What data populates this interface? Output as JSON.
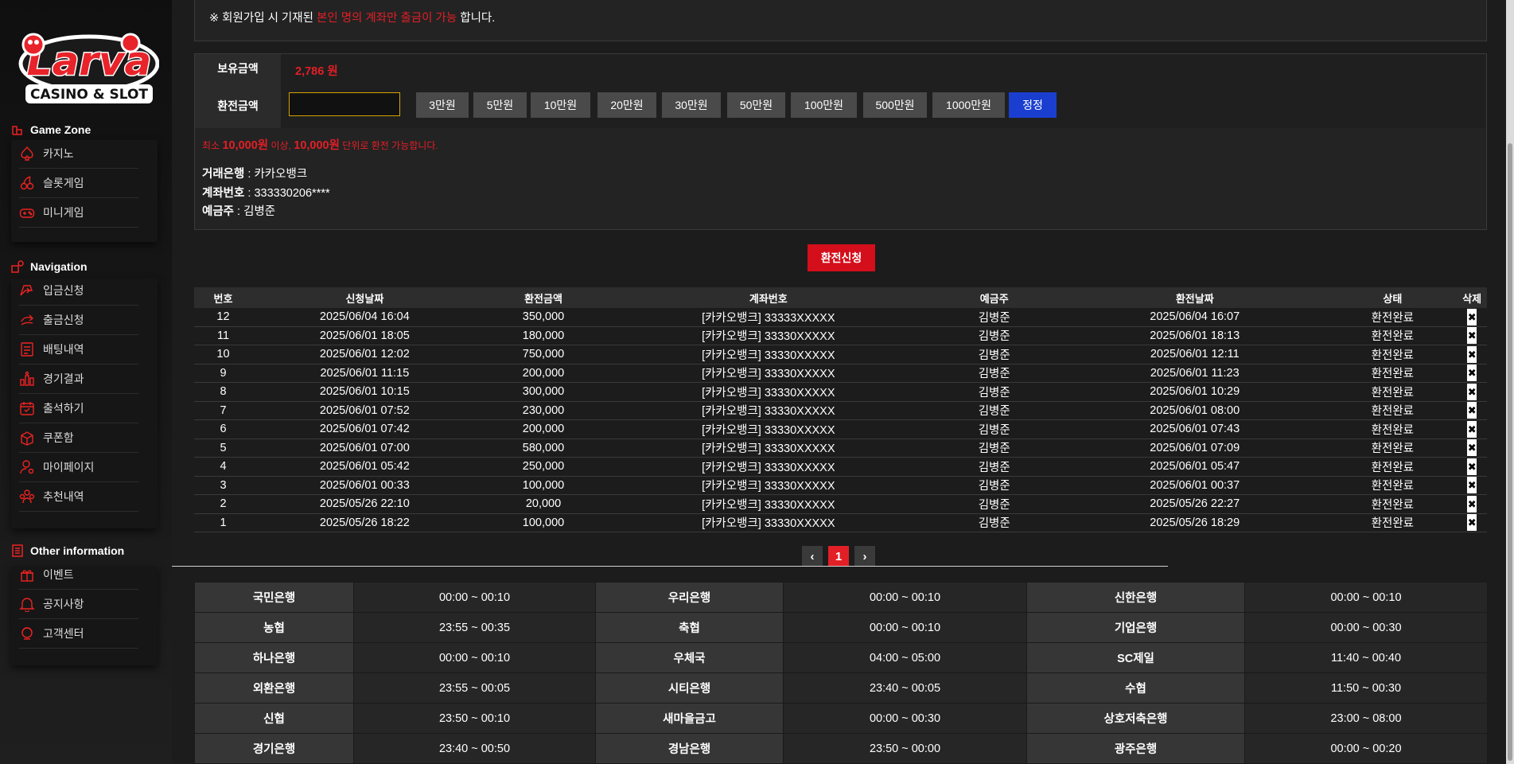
{
  "logo": {
    "brand": "Larva",
    "tagline": "CASINO & SLOT"
  },
  "sidebar": {
    "sections": [
      {
        "title": "Game Zone",
        "icon": "game-zone-icon",
        "items": [
          {
            "label": "카지노",
            "icon": "spade-icon"
          },
          {
            "label": "슬롯게임",
            "icon": "cherry-icon"
          },
          {
            "label": "미니게임",
            "icon": "gamepad-icon"
          }
        ]
      },
      {
        "title": "Navigation",
        "icon": "navigation-icon",
        "items": [
          {
            "label": "입금신청",
            "icon": "deposit-icon"
          },
          {
            "label": "출금신청",
            "icon": "withdraw-icon"
          },
          {
            "label": "배팅내역",
            "icon": "bet-history-icon"
          },
          {
            "label": "경기결과",
            "icon": "results-icon"
          },
          {
            "label": "출석하기",
            "icon": "calendar-icon"
          },
          {
            "label": "쿠폰함",
            "icon": "coupon-icon"
          },
          {
            "label": "마이페이지",
            "icon": "user-icon"
          },
          {
            "label": "추천내역",
            "icon": "referral-icon"
          }
        ]
      },
      {
        "title": "Other information",
        "icon": "info-icon",
        "items": [
          {
            "label": "이벤트",
            "icon": "gift-icon"
          },
          {
            "label": "공지사항",
            "icon": "bell-icon"
          },
          {
            "label": "고객센터",
            "icon": "support-icon"
          }
        ]
      }
    ]
  },
  "notice": {
    "prefix": "※ 회원가입 시 기재된",
    "highlight": "본인 명의 계좌만 출금이 가능",
    "suffix": "합니다."
  },
  "form": {
    "balance_label": "보유금액",
    "balance_value": "2,786 원",
    "amount_label": "환전금액",
    "amount_value": "",
    "amount_placeholder": "",
    "amount_buttons": [
      "3만원",
      "5만원",
      "10만원",
      "20만원",
      "30만원",
      "50만원",
      "100만원",
      "500만원",
      "1000만원"
    ],
    "reset_label": "정정",
    "min_text": {
      "p1": "최소",
      "v1": "10,000원",
      "p2": "이상,",
      "v2": "10,000원",
      "p3": "단위로 환전 가능합니다."
    },
    "bank_info": [
      {
        "label": "거래은행",
        "value": "카카오뱅크"
      },
      {
        "label": "계좌번호",
        "value": "333330206****"
      },
      {
        "label": "예금주",
        "value": "김병준"
      }
    ],
    "submit_label": "환전신청"
  },
  "history": {
    "columns": [
      "번호",
      "신청날짜",
      "환전금액",
      "계좌번호",
      "예금주",
      "환전날짜",
      "상태",
      "삭제"
    ],
    "delete_symbol": "✖",
    "rows": [
      [
        "12",
        "2025/06/04 16:04",
        "350,000",
        "[카카오뱅크] 33333XXXXX",
        "김병준",
        "2025/06/04 16:07",
        "환전완료"
      ],
      [
        "11",
        "2025/06/01 18:05",
        "180,000",
        "[카카오뱅크] 33330XXXXX",
        "김병준",
        "2025/06/01 18:13",
        "환전완료"
      ],
      [
        "10",
        "2025/06/01 12:02",
        "750,000",
        "[카카오뱅크] 33330XXXXX",
        "김병준",
        "2025/06/01 12:11",
        "환전완료"
      ],
      [
        "9",
        "2025/06/01 11:15",
        "200,000",
        "[카카오뱅크] 33330XXXXX",
        "김병준",
        "2025/06/01 11:23",
        "환전완료"
      ],
      [
        "8",
        "2025/06/01 10:15",
        "300,000",
        "[카카오뱅크] 33330XXXXX",
        "김병준",
        "2025/06/01 10:29",
        "환전완료"
      ],
      [
        "7",
        "2025/06/01 07:52",
        "230,000",
        "[카카오뱅크] 33330XXXXX",
        "김병준",
        "2025/06/01 08:00",
        "환전완료"
      ],
      [
        "6",
        "2025/06/01 07:42",
        "200,000",
        "[카카오뱅크] 33330XXXXX",
        "김병준",
        "2025/06/01 07:43",
        "환전완료"
      ],
      [
        "5",
        "2025/06/01 07:00",
        "580,000",
        "[카카오뱅크] 33330XXXXX",
        "김병준",
        "2025/06/01 07:09",
        "환전완료"
      ],
      [
        "4",
        "2025/06/01 05:42",
        "250,000",
        "[카카오뱅크] 33330XXXXX",
        "김병준",
        "2025/06/01 05:47",
        "환전완료"
      ],
      [
        "3",
        "2025/06/01 00:33",
        "100,000",
        "[카카오뱅크] 33330XXXXX",
        "김병준",
        "2025/06/01 00:37",
        "환전완료"
      ],
      [
        "2",
        "2025/05/26 22:10",
        "20,000",
        "[카카오뱅크] 33330XXXXX",
        "김병준",
        "2025/05/26 22:27",
        "환전완료"
      ],
      [
        "1",
        "2025/05/26 18:22",
        "100,000",
        "[카카오뱅크] 33330XXXXX",
        "김병준",
        "2025/05/26 18:29",
        "환전완료"
      ]
    ]
  },
  "pagination": {
    "prev": "‹",
    "current": "1",
    "next": "›"
  },
  "bank_hours": [
    [
      {
        "bank": "국민은행",
        "hours": "00:00 ~ 00:10"
      },
      {
        "bank": "우리은행",
        "hours": "00:00 ~ 00:10"
      },
      {
        "bank": "신한은행",
        "hours": "00:00 ~ 00:10"
      }
    ],
    [
      {
        "bank": "농협",
        "hours": "23:55 ~ 00:35"
      },
      {
        "bank": "축협",
        "hours": "00:00 ~ 00:10"
      },
      {
        "bank": "기업은행",
        "hours": "00:00 ~ 00:30"
      }
    ],
    [
      {
        "bank": "하나은행",
        "hours": "00:00 ~ 00:10"
      },
      {
        "bank": "우체국",
        "hours": "04:00 ~ 05:00"
      },
      {
        "bank": "SC제일",
        "hours": "11:40 ~ 00:40"
      }
    ],
    [
      {
        "bank": "외환은행",
        "hours": "23:55 ~ 00:05"
      },
      {
        "bank": "시티은행",
        "hours": "23:40 ~ 00:05"
      },
      {
        "bank": "수협",
        "hours": "11:50 ~ 00:30"
      }
    ],
    [
      {
        "bank": "신협",
        "hours": "23:50 ~ 00:10"
      },
      {
        "bank": "새마을금고",
        "hours": "00:00 ~ 00:30"
      },
      {
        "bank": "상호저축은행",
        "hours": "23:00 ~ 08:00"
      }
    ],
    [
      {
        "bank": "경기은행",
        "hours": "23:40 ~ 00:50"
      },
      {
        "bank": "경남은행",
        "hours": "23:50 ~ 00:00"
      },
      {
        "bank": "광주은행",
        "hours": "00:00 ~ 00:20"
      }
    ]
  ],
  "colors": {
    "accent_red": "#e21f26",
    "reset_blue": "#1a3fd0",
    "input_border": "#d8a300"
  }
}
